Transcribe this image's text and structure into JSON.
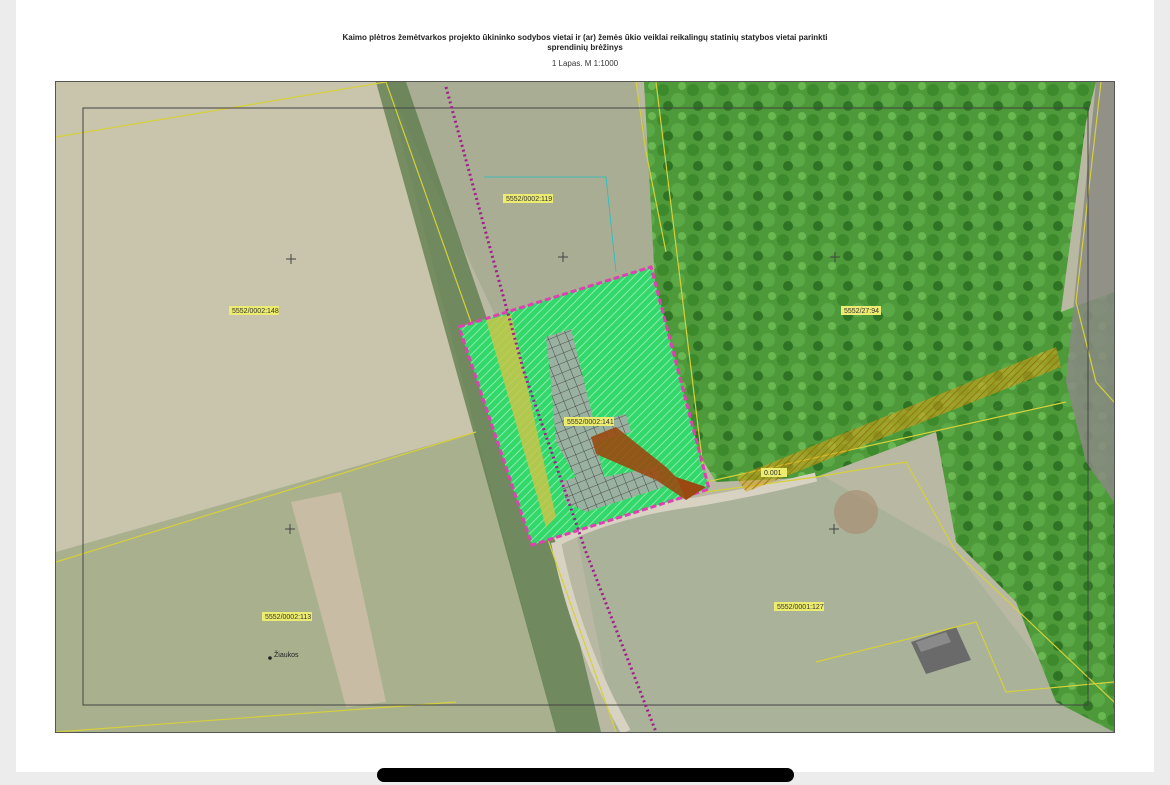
{
  "document": {
    "title_line1": "Kaimo plėtros žemėtvarkos projekto ūkininko sodybos vietai ir (ar) žemės ūkio veiklai reikalingų statinių statybos vietai parinkti",
    "title_line2": "sprendinių brėžinys",
    "subtitle": "1 Lapas. M 1:1000"
  },
  "map": {
    "parcels": [
      "5552/0002:148",
      "5552/0002:119",
      "5552/27:94",
      "5552/0002:113",
      "5552/0001:127",
      "5552/0002:141"
    ],
    "place_label": "Žiaukos",
    "road_label": "0.001",
    "colors": {
      "field": "#b9b9a3",
      "forest": "#4e9a3a",
      "selected_area": "#33d86a",
      "boundary": "#e040b0",
      "utility_line": "#a0208a",
      "parcel_line": "#d6d03a",
      "easement": "#d8a418",
      "access_arrow": "#9a4a10"
    }
  }
}
